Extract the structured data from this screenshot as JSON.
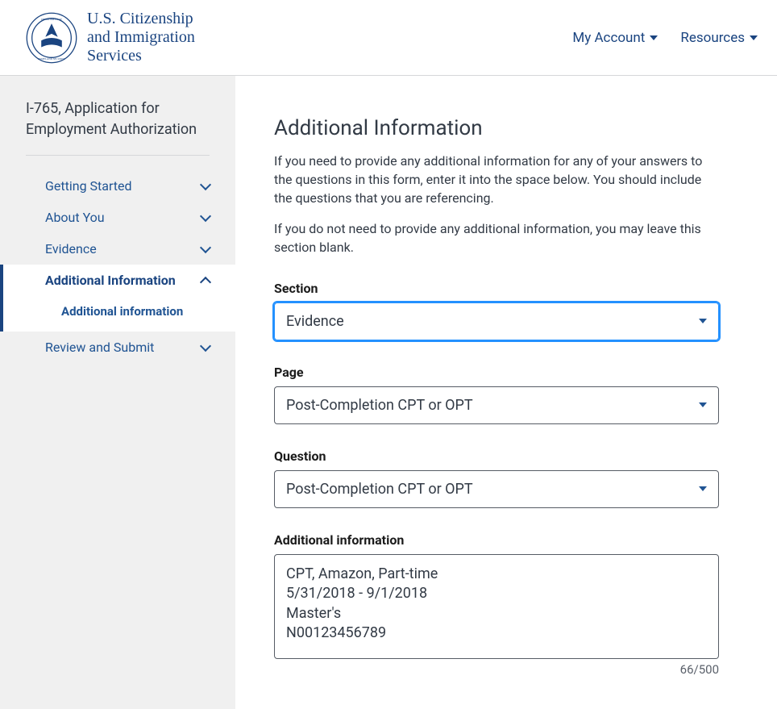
{
  "header": {
    "brand_line1": "U.S. Citizenship",
    "brand_line2": "and Immigration",
    "brand_line3": "Services",
    "nav": {
      "my_account": "My Account",
      "resources": "Resources"
    }
  },
  "sidebar": {
    "title": "I-765, Application for Employment Authorization",
    "items": [
      {
        "label": "Getting Started",
        "active": false
      },
      {
        "label": "About You",
        "active": false
      },
      {
        "label": "Evidence",
        "active": false
      },
      {
        "label": "Additional Information",
        "active": true,
        "sub": "Additional information"
      },
      {
        "label": "Review and Submit",
        "active": false
      }
    ]
  },
  "main": {
    "title": "Additional Information",
    "intro1": "If you need to provide any additional information for any of your answers to the questions in this form, enter it into the space below. You should include the questions that you are referencing.",
    "intro2": "If you do not need to provide any additional information, you may leave this section blank.",
    "fields": {
      "section": {
        "label": "Section",
        "value": "Evidence"
      },
      "page": {
        "label": "Page",
        "value": "Post-Completion CPT or OPT"
      },
      "question": {
        "label": "Question",
        "value": "Post-Completion CPT or OPT"
      },
      "additional_info": {
        "label": "Additional information",
        "value": "CPT, Amazon, Part-time\n5/31/2018 - 9/1/2018\nMaster's\nN00123456789",
        "char_count": "66/500"
      }
    }
  }
}
